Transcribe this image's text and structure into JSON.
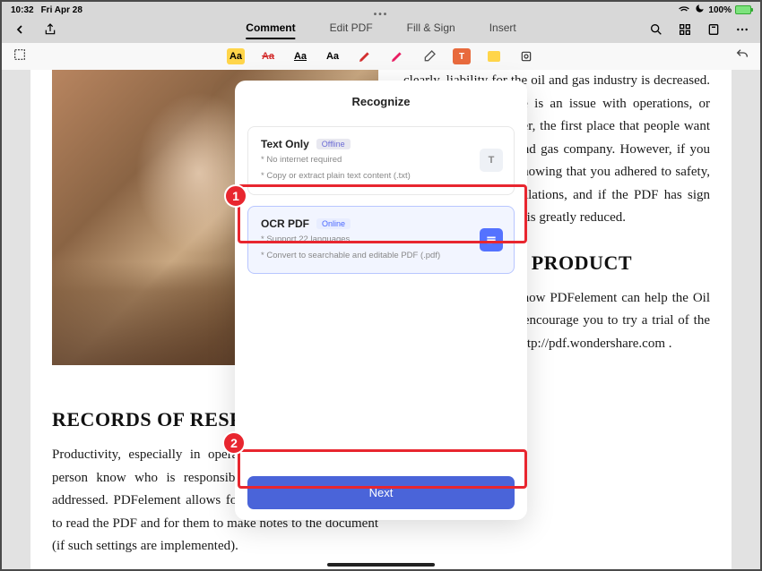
{
  "status": {
    "time": "10:32",
    "date": "Fri Apr 28",
    "battery": "100%"
  },
  "tabs": {
    "comment": "Comment",
    "edit": "Edit PDF",
    "fill": "Fill & Sign",
    "insert": "Insert"
  },
  "modal": {
    "title": "Recognize",
    "option1": {
      "title": "Text Only",
      "badge": "Offline",
      "desc1": "* No internet required",
      "desc2": "* Copy or extract plain text content (.txt)",
      "icon": "T"
    },
    "option2": {
      "title": "OCR PDF",
      "badge": "Online",
      "desc1": "* Support 22 languages",
      "desc2": "* Convert to searchable and editable PDF (.pdf)"
    },
    "next": "Next"
  },
  "callouts": {
    "one": "1",
    "two": "2"
  },
  "doc": {
    "left_heading": "RECORDS OF RESPONSIBILITY",
    "left_body": "Productivity, especially in operations, requires that each person know who is responsible to whom the task is addressed. PDFelement allows for the various departments to read the PDF and for them to make notes to the document (if such settings are implemented).",
    "right_body1": "clearly, liability for the oil and gas industry is decreased. Generally, when there is an issue with operations, or when there is a disaster, the first place that people want to look to is the oil and gas company. However, if you have documentation showing that you adhered to safety, standards, and to regulations, and if the PDF has sign offs and such, liability is greatly reduced.",
    "right_heading": "ABOUT OUR PRODUCT",
    "right_body2": "To know more about how PDFelement can help the Oil and Gas industry, we encourage you to try a trial of the software please visit http://pdf.wondershare.com ."
  }
}
